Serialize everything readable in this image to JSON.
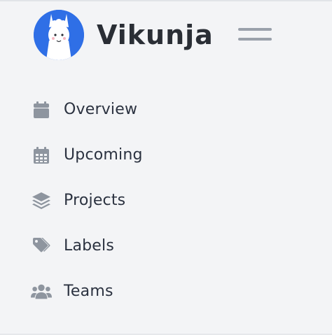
{
  "app": {
    "name": "Vikunja"
  },
  "colors": {
    "background": "#f3f4f6",
    "logo_circle": "#2f6fe6",
    "icon": "#8e959f",
    "text": "#2b3240",
    "hamburger": "#9aa1ab"
  },
  "menu_toggle": {
    "icon": "hamburger-icon"
  },
  "nav": {
    "items": [
      {
        "label": "Overview",
        "icon": "calendar-icon"
      },
      {
        "label": "Upcoming",
        "icon": "calendar-grid-icon"
      },
      {
        "label": "Projects",
        "icon": "layers-icon"
      },
      {
        "label": "Labels",
        "icon": "tags-icon"
      },
      {
        "label": "Teams",
        "icon": "users-icon"
      }
    ]
  }
}
